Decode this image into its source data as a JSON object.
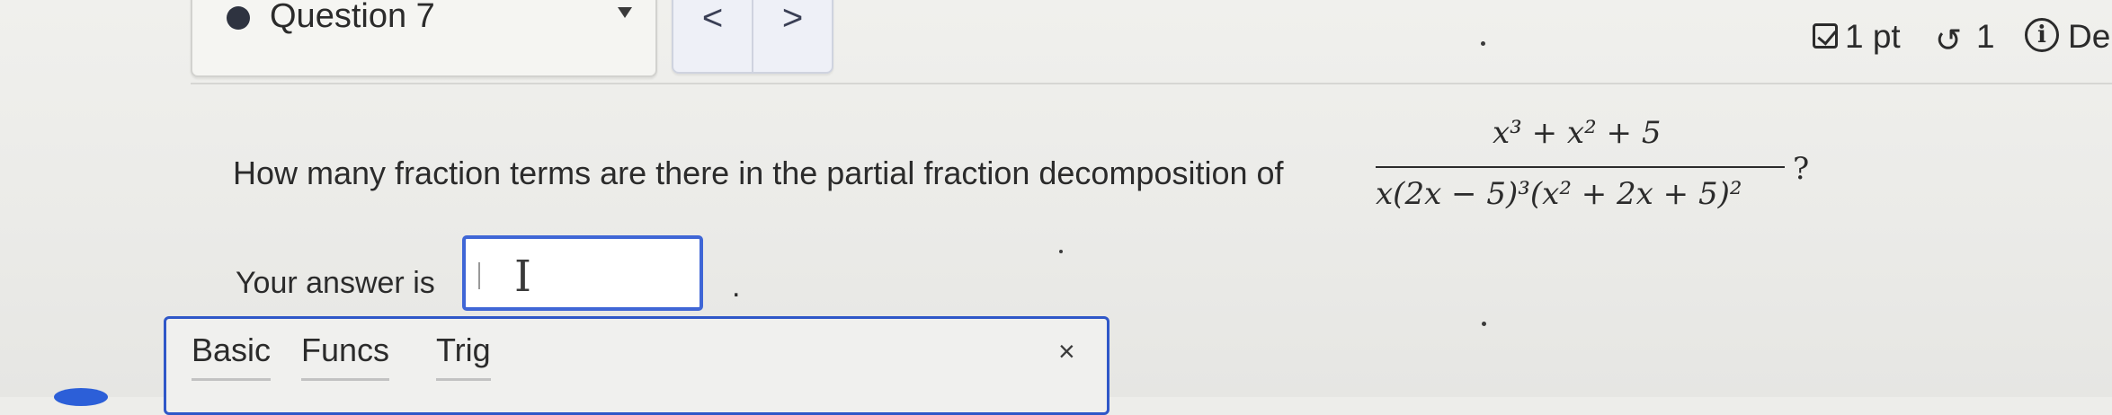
{
  "header": {
    "question_label": "Question 7",
    "prev_label": "<",
    "next_label": ">",
    "points": "1 pt",
    "retries": "1",
    "details_partial": "De"
  },
  "question": {
    "prompt": "How many fraction terms are there in the partial fraction decomposition of",
    "numerator": "x³ + x² + 5",
    "denominator": "x(2x − 5)³(x² + 2x + 5)²",
    "question_mark": "?"
  },
  "answer": {
    "label": "Your answer is",
    "value": "",
    "suffix": "."
  },
  "keypad": {
    "tabs": [
      "Basic",
      "Funcs",
      "Trig"
    ],
    "close": "×"
  },
  "colors": {
    "accent": "#3f66d6",
    "text": "#2b2b2b",
    "background": "#ededea"
  }
}
